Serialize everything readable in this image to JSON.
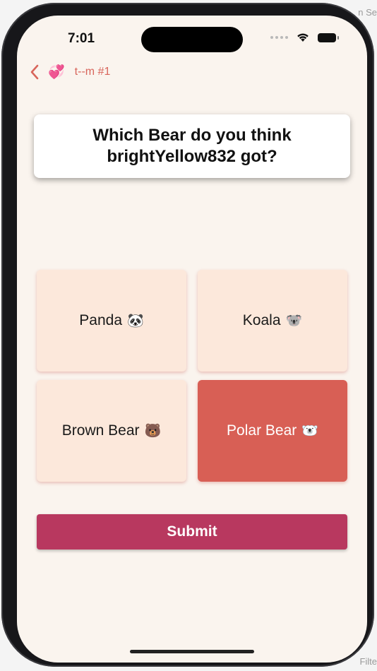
{
  "desktop": {
    "top_hint": "n Se",
    "bottom_hint": "Filte"
  },
  "status_bar": {
    "time": "7:01"
  },
  "nav": {
    "back_icon": "chevron-left-icon",
    "heart_emoji": "💞",
    "title": "t--m #1"
  },
  "question": {
    "text": "Which Bear do you think brightYellow832 got?"
  },
  "options": [
    {
      "label": "Panda",
      "emoji": "🐼",
      "selected": false
    },
    {
      "label": "Koala",
      "emoji": "🐨",
      "selected": false
    },
    {
      "label": "Brown Bear",
      "emoji": "🐻",
      "selected": false
    },
    {
      "label": "Polar Bear",
      "emoji": "🐻‍❄️",
      "selected": true
    }
  ],
  "submit": {
    "label": "Submit"
  },
  "colors": {
    "background": "#faf4ee",
    "option_bg": "#fce8db",
    "option_selected": "#d85f55",
    "submit_bg": "#b8385f",
    "nav_accent": "#d8655b"
  }
}
